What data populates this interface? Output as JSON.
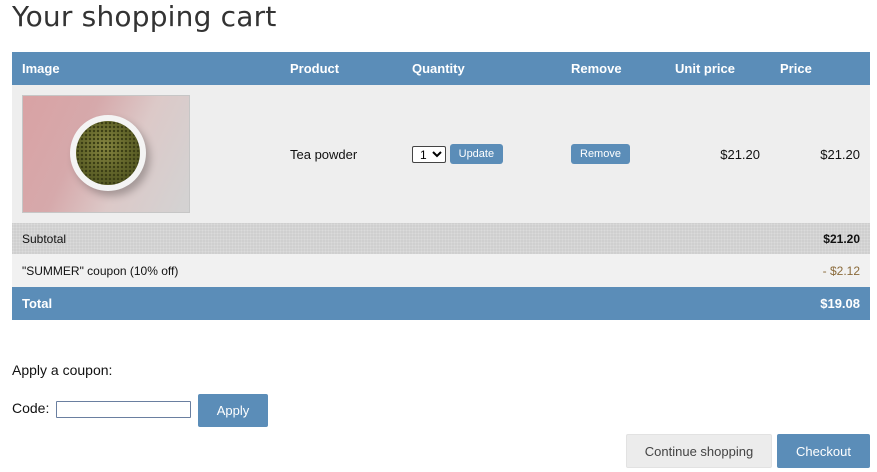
{
  "page": {
    "title": "Your shopping cart"
  },
  "cart": {
    "headers": {
      "image": "Image",
      "product": "Product",
      "quantity": "Quantity",
      "remove": "Remove",
      "unit_price": "Unit price",
      "price": "Price"
    },
    "items": [
      {
        "image_icon": "tea-powder-bowl-image",
        "product": "Tea powder",
        "quantity": "1",
        "quantity_options": [
          "1"
        ],
        "update_label": "Update",
        "remove_label": "Remove",
        "unit_price": "$21.20",
        "price": "$21.20"
      }
    ],
    "subtotal": {
      "label": "Subtotal",
      "value": "$21.20"
    },
    "coupon": {
      "label": "\"SUMMER\" coupon (10% off)",
      "value": "- $2.12"
    },
    "total": {
      "label": "Total",
      "value": "$19.08"
    }
  },
  "coupon_form": {
    "heading": "Apply a coupon:",
    "code_label": "Code:",
    "code_value": "",
    "apply_label": "Apply"
  },
  "actions": {
    "continue_label": "Continue shopping",
    "checkout_label": "Checkout"
  },
  "colors": {
    "accent": "#5b8db8",
    "row_bg": "#eeeeee",
    "subtotal_bg": "#cfcfcf",
    "discount_text": "#8a6a3a"
  }
}
